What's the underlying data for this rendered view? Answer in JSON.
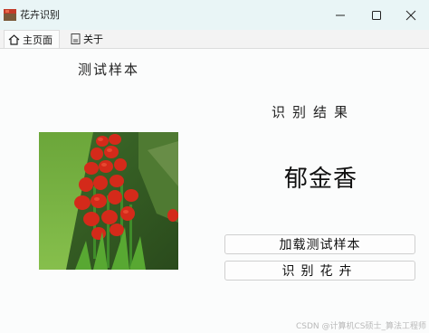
{
  "window": {
    "title": "花卉识别",
    "minimize_icon": "minimize-icon",
    "maximize_icon": "maximize-icon",
    "close_icon": "close-icon"
  },
  "tabs": [
    {
      "label": "主页面",
      "icon": "home-icon",
      "active": true
    },
    {
      "label": "关于",
      "icon": "document-icon",
      "active": false
    }
  ],
  "main": {
    "sample_title": "测试样本",
    "result_title": "识别结果",
    "result_value": "郁金香",
    "load_button": "加载测试样本",
    "identify_button": "识别花卉"
  },
  "watermark": "CSDN @计算机CS硕士_算法工程师",
  "colors": {
    "titlebar_bg": "#e9f5f6",
    "accent_flower": "#d42a1a",
    "grass": "#6aa83a"
  }
}
